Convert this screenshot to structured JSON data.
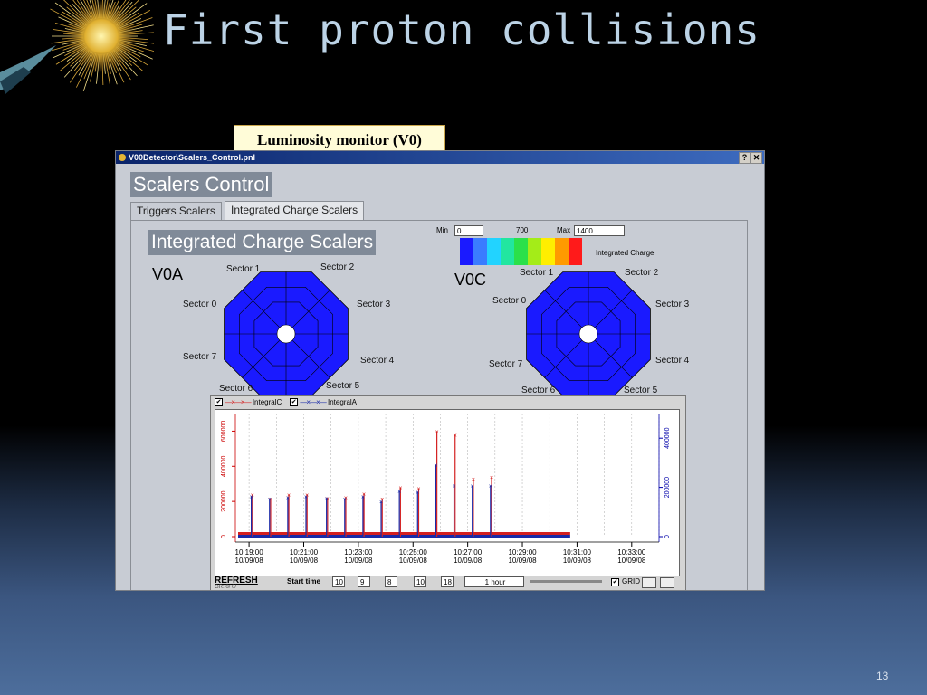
{
  "slide": {
    "title": "First proton collisions",
    "page_number": "13"
  },
  "callout": {
    "text": "Luminosity monitor (V0)"
  },
  "window": {
    "title": "V00Detector\\Scalers_Control.pnl",
    "help_button": "?",
    "close_button": "✕",
    "panel_title": "Scalers Control",
    "tabs": [
      {
        "label": "Triggers Scalers",
        "active": false
      },
      {
        "label": "Integrated Charge Scalers",
        "active": true
      }
    ]
  },
  "scalers": {
    "title": "Integrated Charge Scalers",
    "v0a": {
      "label": "V0A",
      "sectors": [
        "Sector 1",
        "Sector 2",
        "Sector 0",
        "Sector 3",
        "Sector 7",
        "Sector 4",
        "Sector 6",
        "Sector 5"
      ]
    },
    "v0c": {
      "label": "V0C",
      "sectors": [
        "Sector 1",
        "Sector 2",
        "Sector 0",
        "Sector 3",
        "Sector 7",
        "Sector 4",
        "Sector 6",
        "Sector 5"
      ]
    },
    "ring_color": "#1a1aff",
    "scale": {
      "min_label": "Min",
      "min_value": "0",
      "mid_label": "700",
      "max_label": "Max",
      "max_value": "1400",
      "legend_label": "Integrated Charge",
      "colors": [
        "#1a1aff",
        "#3a7cff",
        "#22d3ff",
        "#22e6a0",
        "#2be04a",
        "#a4ec18",
        "#ffee00",
        "#ff9a00",
        "#ff1a1a"
      ]
    }
  },
  "plot": {
    "legend": [
      {
        "label": "IntegralC",
        "checked": "✔",
        "color": "#d42020"
      },
      {
        "label": "IntegralA",
        "checked": "✔",
        "color": "#1a2aa8"
      }
    ],
    "refresh_label": "REFRESH",
    "status": "GR: 0/ 0/",
    "start_time_label": "Start time",
    "start_fields": [
      "10",
      "9",
      "8",
      "10",
      "18"
    ],
    "period": "1 hour",
    "grid_label": "GRID",
    "grid_checked": "✔"
  },
  "chart_data": {
    "type": "line",
    "x_ticks": [
      {
        "time": "10:19:00",
        "date": "10/09/08"
      },
      {
        "time": "10:21:00",
        "date": "10/09/08"
      },
      {
        "time": "10:23:00",
        "date": "10/09/08"
      },
      {
        "time": "10:25:00",
        "date": "10/09/08"
      },
      {
        "time": "10:27:00",
        "date": "10/09/08"
      },
      {
        "time": "10:29:00",
        "date": "10/09/08"
      },
      {
        "time": "10:31:00",
        "date": "10/09/08"
      },
      {
        "time": "10:33:00",
        "date": "10/09/08"
      }
    ],
    "y_left_ticks": [
      "0",
      "200000",
      "400000",
      "600000"
    ],
    "y_right_ticks": [
      "0",
      "200000",
      "400000"
    ],
    "ylim_left": [
      0,
      700000
    ],
    "ylim_right": [
      0,
      500000
    ],
    "xlim": [
      "10:18:30",
      "10:34:00"
    ],
    "series": [
      {
        "name": "IntegralC",
        "color": "#d42020",
        "spikes": [
          {
            "t": "10:19:05",
            "y": 240000
          },
          {
            "t": "10:19:45",
            "y": 215000
          },
          {
            "t": "10:20:25",
            "y": 240000
          },
          {
            "t": "10:21:05",
            "y": 240000
          },
          {
            "t": "10:21:50",
            "y": 220000
          },
          {
            "t": "10:22:30",
            "y": 225000
          },
          {
            "t": "10:23:10",
            "y": 245000
          },
          {
            "t": "10:23:50",
            "y": 215000
          },
          {
            "t": "10:24:30",
            "y": 280000
          },
          {
            "t": "10:25:10",
            "y": 275000
          },
          {
            "t": "10:25:50",
            "y": 600000
          },
          {
            "t": "10:26:30",
            "y": 580000
          },
          {
            "t": "10:27:10",
            "y": 330000
          },
          {
            "t": "10:27:50",
            "y": 340000
          }
        ]
      },
      {
        "name": "IntegralA",
        "color": "#1a2aa8",
        "spikes": [
          {
            "t": "10:19:05",
            "y": 230000
          },
          {
            "t": "10:19:45",
            "y": 215000
          },
          {
            "t": "10:20:25",
            "y": 225000
          },
          {
            "t": "10:21:05",
            "y": 230000
          },
          {
            "t": "10:21:50",
            "y": 220000
          },
          {
            "t": "10:22:30",
            "y": 215000
          },
          {
            "t": "10:23:10",
            "y": 230000
          },
          {
            "t": "10:23:50",
            "y": 200000
          },
          {
            "t": "10:24:30",
            "y": 260000
          },
          {
            "t": "10:25:10",
            "y": 255000
          },
          {
            "t": "10:25:50",
            "y": 410000
          },
          {
            "t": "10:26:30",
            "y": 290000
          },
          {
            "t": "10:27:10",
            "y": 290000
          },
          {
            "t": "10:27:50",
            "y": 290000
          }
        ]
      }
    ],
    "baseline_end": "10:30:45",
    "grid": true
  }
}
